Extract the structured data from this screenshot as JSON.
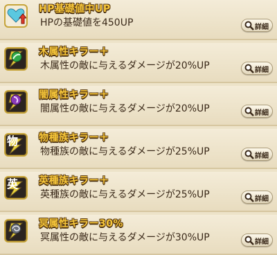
{
  "skills": [
    {
      "title": "HP基礎値中UP",
      "desc": "HPの基礎値を450UP",
      "detail_label": "詳細",
      "icon": "heart-up-icon",
      "icon_char": ""
    },
    {
      "title": "木属性キラー＋",
      "desc": "木属性の敵に与えるダメージが20%UP",
      "detail_label": "詳細",
      "icon": "wood-element-icon",
      "icon_char": ""
    },
    {
      "title": "闇属性キラー＋",
      "desc": "闇属性の敵に与えるダメージが20%UP",
      "detail_label": "詳細",
      "icon": "dark-element-icon",
      "icon_char": ""
    },
    {
      "title": "物種族キラー＋",
      "desc": "物種族の敵に与えるダメージが25%UP",
      "detail_label": "詳細",
      "icon": "material-race-icon",
      "icon_char": "物"
    },
    {
      "title": "英種族キラー＋",
      "desc": "英種族の敵に与えるダメージが25%UP",
      "detail_label": "詳細",
      "icon": "hero-race-icon",
      "icon_char": "英"
    },
    {
      "title": "冥属性キラー30%",
      "desc": "冥属性の敵に与えるダメージが30%UP",
      "detail_label": "詳細",
      "icon": "nether-element-icon",
      "icon_char": ""
    }
  ]
}
